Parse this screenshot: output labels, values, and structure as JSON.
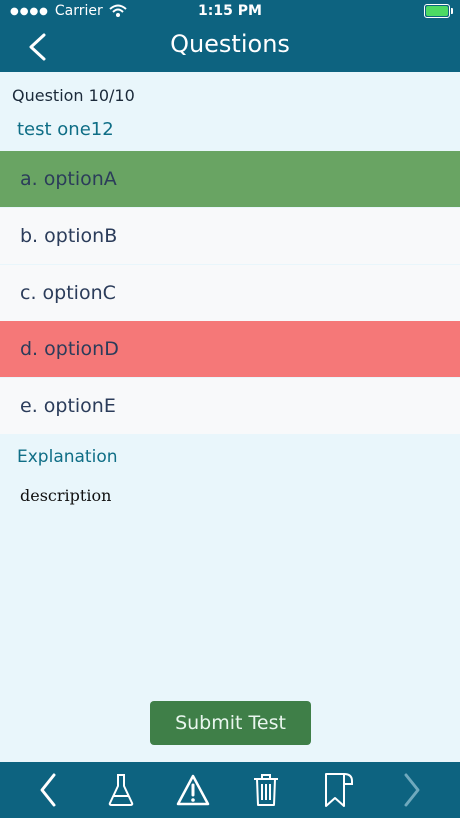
{
  "status": {
    "carrier": "Carrier",
    "time": "1:15 PM"
  },
  "header": {
    "title": "Questions"
  },
  "question": {
    "counter": "Question 10/10",
    "text": "test one12",
    "options": [
      {
        "label": "a. optionA",
        "state": "correct"
      },
      {
        "label": "b. optionB",
        "state": "normal"
      },
      {
        "label": "c. optionC",
        "state": "normal"
      },
      {
        "label": "d. optionD",
        "state": "wrong"
      },
      {
        "label": "e. optionE",
        "state": "normal"
      }
    ]
  },
  "explanation": {
    "title": "Explanation",
    "text": "description"
  },
  "actions": {
    "submit_label": "Submit Test"
  },
  "toolbar": {
    "icons": [
      "chevron-left-icon",
      "flask-icon",
      "warning-icon",
      "trash-icon",
      "bookmark-icon",
      "chevron-right-icon"
    ]
  },
  "colors": {
    "bar": "#0d6380",
    "background": "#e9f6fb",
    "correct": "#69a463",
    "wrong": "#f57878",
    "submit": "#3f7f48"
  }
}
